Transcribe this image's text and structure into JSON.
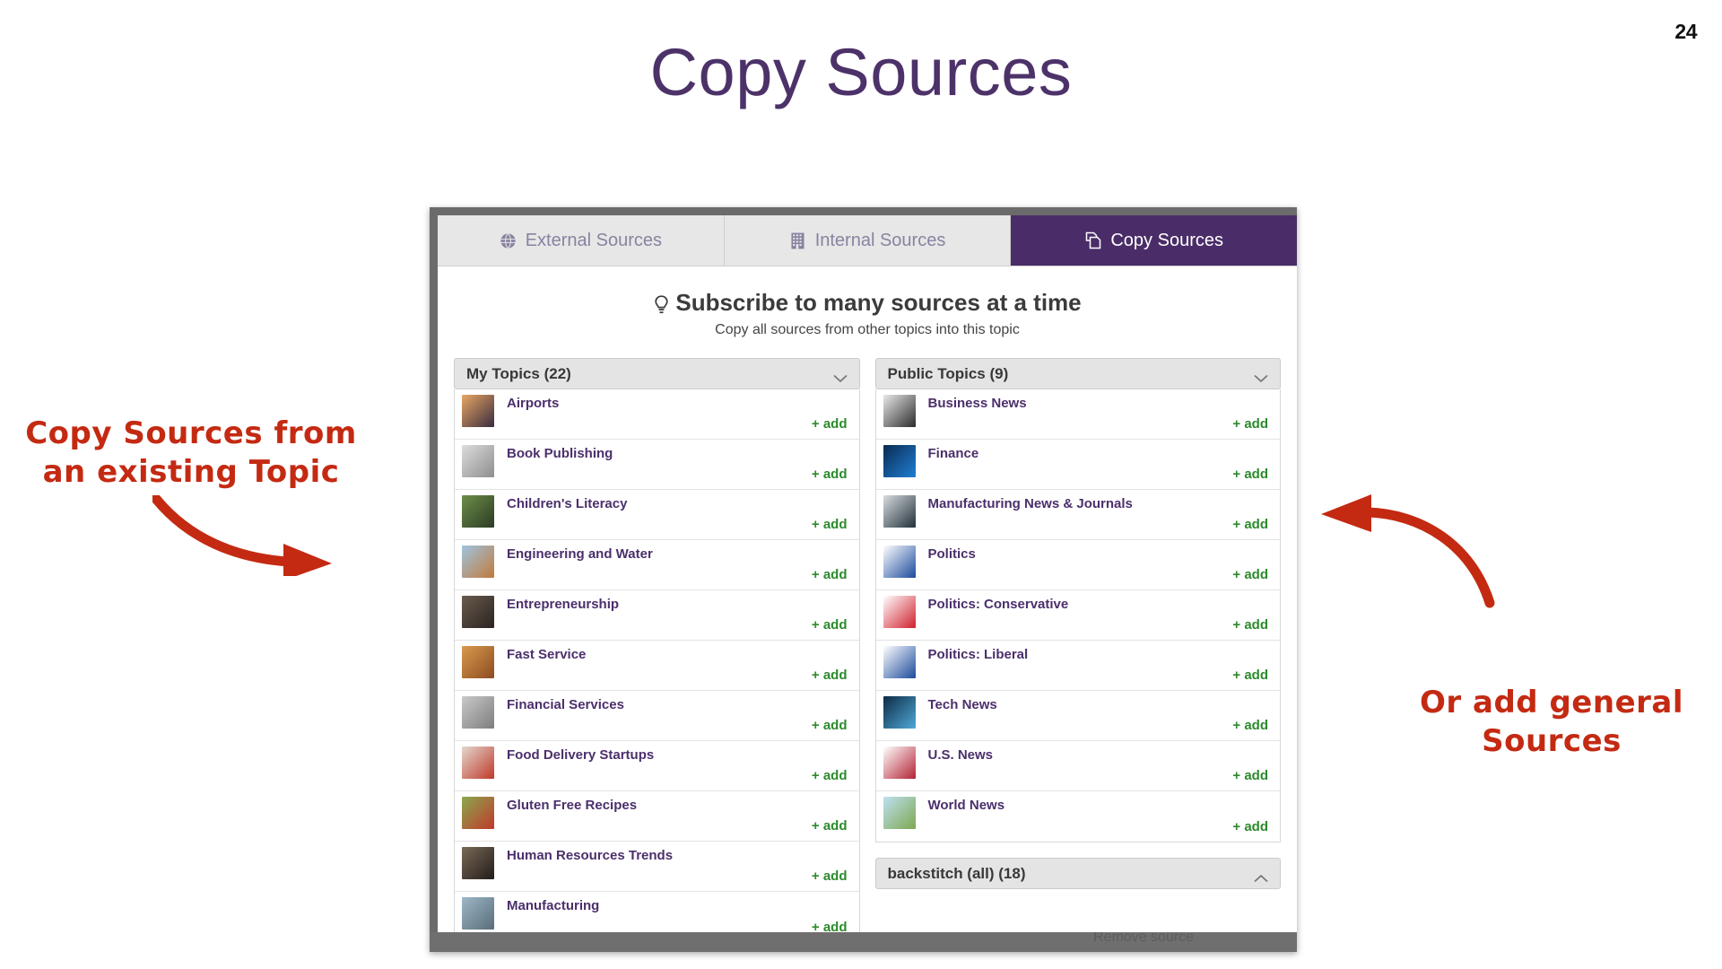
{
  "slide": {
    "number": "24",
    "title": "Copy Sources"
  },
  "annotations": {
    "left": "Copy Sources from\nan existing Topic",
    "right": "Or add general\nSources"
  },
  "window": {
    "ghost_footer_text": "Remove source"
  },
  "tabs": [
    {
      "label": "External Sources",
      "icon": "globe-icon",
      "active": false
    },
    {
      "label": "Internal Sources",
      "icon": "building-icon",
      "active": false
    },
    {
      "label": "Copy Sources",
      "icon": "copy-pages-icon",
      "active": true
    }
  ],
  "panel": {
    "heading": "Subscribe to many sources at a time",
    "heading_icon": "lightbulb-icon",
    "subheading": "Copy all sources from other topics into this topic"
  },
  "columns": {
    "left": {
      "group_label": "My Topics (22)",
      "collapse_icon": "chevron-down-icon",
      "add_label": "+ add",
      "items": [
        {
          "name": "Airports",
          "thumb": "airport-sunset-thumb",
          "c1": "#e8a764",
          "c2": "#3a2b3f"
        },
        {
          "name": "Book Publishing",
          "thumb": "book-publishing-thumb",
          "c1": "#dcdcdc",
          "c2": "#8e8e8e"
        },
        {
          "name": "Children's Literacy",
          "thumb": "childrens-literacy-thumb",
          "c1": "#6d8f4a",
          "c2": "#2c3a24"
        },
        {
          "name": "Engineering and Water",
          "thumb": "engineering-water-thumb",
          "c1": "#9fc4e0",
          "c2": "#c07a3c"
        },
        {
          "name": "Entrepreneurship",
          "thumb": "entrepreneurship-thumb",
          "c1": "#6a5b4d",
          "c2": "#2a2320"
        },
        {
          "name": "Fast Service",
          "thumb": "fast-service-thumb",
          "c1": "#d89a4e",
          "c2": "#8e4b20"
        },
        {
          "name": "Financial Services",
          "thumb": "financial-services-thumb",
          "c1": "#c9c9c9",
          "c2": "#7d7d7d"
        },
        {
          "name": "Food Delivery Startups",
          "thumb": "food-delivery-thumb",
          "c1": "#e3d8cd",
          "c2": "#c0392b"
        },
        {
          "name": "Gluten Free Recipes",
          "thumb": "gluten-free-recipes-thumb",
          "c1": "#8aa84f",
          "c2": "#c0392b"
        },
        {
          "name": "Human Resources Trends",
          "thumb": "hr-trends-thumb",
          "c1": "#7a6a58",
          "c2": "#221c18"
        },
        {
          "name": "Manufacturing",
          "thumb": "manufacturing-thumb",
          "c1": "#9db7c7",
          "c2": "#5a6d79"
        }
      ]
    },
    "right": {
      "group_label": "Public Topics (9)",
      "collapse_icon": "chevron-down-icon",
      "add_label": "+ add",
      "footer_label": "backstitch (all) (18)",
      "footer_icon": "chevron-up-icon",
      "items": [
        {
          "name": "Business News",
          "thumb": "business-news-thumb",
          "c1": "#e9e9e9",
          "c2": "#2b2b2b"
        },
        {
          "name": "Finance",
          "thumb": "finance-thumb",
          "c1": "#0a2a52",
          "c2": "#1f7fd4"
        },
        {
          "name": "Manufacturing News & Journals",
          "thumb": "manufacturing-news-thumb",
          "c1": "#d8dde0",
          "c2": "#22303a"
        },
        {
          "name": "Politics",
          "thumb": "politics-thumb",
          "c1": "#ffffff",
          "c2": "#1b4a9c"
        },
        {
          "name": "Politics: Conservative",
          "thumb": "republican-elephant-thumb",
          "c1": "#ffffff",
          "c2": "#d0202c"
        },
        {
          "name": "Politics: Liberal",
          "thumb": "democrat-donkey-thumb",
          "c1": "#ffffff",
          "c2": "#1b4a9c"
        },
        {
          "name": "Tech News",
          "thumb": "tech-news-thumb",
          "c1": "#0d2a44",
          "c2": "#4fa9d8"
        },
        {
          "name": "U.S. News",
          "thumb": "us-flag-thumb",
          "c1": "#ffffff",
          "c2": "#b22234"
        },
        {
          "name": "World News",
          "thumb": "world-map-thumb",
          "c1": "#bfe0f2",
          "c2": "#7da84f"
        }
      ]
    }
  },
  "colors": {
    "title_purple": "#4c3269",
    "tab_active_bg": "#4a2d68",
    "add_green": "#2c8a2c",
    "annotation_red": "#c42a12",
    "topic_name_purple": "#4b2f6b"
  }
}
